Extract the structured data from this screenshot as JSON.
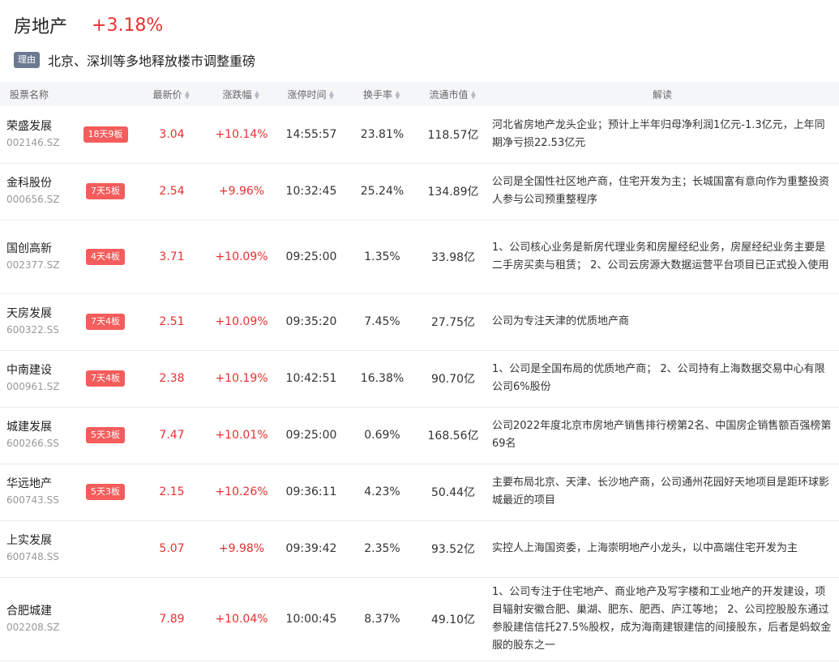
{
  "header": {
    "sector": "房地产",
    "change": "+3.18%"
  },
  "reason": {
    "tag": "理由",
    "text": "北京、深圳等多地释放楼市调整重磅"
  },
  "columns": {
    "name": "股票名称",
    "price": "最新价",
    "change": "涨跌幅",
    "limit_time": "涨停时间",
    "turnover": "换手率",
    "cap": "流通市值",
    "desc": "解读"
  },
  "colors": {
    "up": "#e93030",
    "badge": "#f55c5c",
    "reason_tag": "#6b7a90"
  },
  "rows": [
    {
      "name": "荣盛发展",
      "code": "002146.SZ",
      "badge": "18天9板",
      "price": "3.04",
      "change": "+10.14%",
      "time": "14:55:57",
      "turnover": "23.81%",
      "cap": "118.57亿",
      "desc": "河北省房地产龙头企业；预计上半年归母净利润1亿元-1.3亿元，上年同期净亏损22.53亿元"
    },
    {
      "name": "金科股份",
      "code": "000656.SZ",
      "badge": "7天5板",
      "price": "2.54",
      "change": "+9.96%",
      "time": "10:32:45",
      "turnover": "25.24%",
      "cap": "134.89亿",
      "desc": "公司是全国性社区地产商，住宅开发为主；长城国富有意向作为重整投资人参与公司预重整程序"
    },
    {
      "name": "国创高新",
      "code": "002377.SZ",
      "badge": "4天4板",
      "price": "3.71",
      "change": "+10.09%",
      "time": "09:25:00",
      "turnover": "1.35%",
      "cap": "33.98亿",
      "desc": "1、公司核心业务是新房代理业务和房屋经纪业务，房屋经纪业务主要是二手房买卖与租赁； 2、公司云房源大数据运营平台项目已正式投入使用"
    },
    {
      "name": "天房发展",
      "code": "600322.SS",
      "badge": "7天4板",
      "price": "2.51",
      "change": "+10.09%",
      "time": "09:35:20",
      "turnover": "7.45%",
      "cap": "27.75亿",
      "desc": "公司为专注天津的优质地产商"
    },
    {
      "name": "中南建设",
      "code": "000961.SZ",
      "badge": "7天4板",
      "price": "2.38",
      "change": "+10.19%",
      "time": "10:42:51",
      "turnover": "16.38%",
      "cap": "90.70亿",
      "desc": "1、公司是全国布局的优质地产商； 2、公司持有上海数据交易中心有限公司6%股份"
    },
    {
      "name": "城建发展",
      "code": "600266.SS",
      "badge": "5天3板",
      "price": "7.47",
      "change": "+10.01%",
      "time": "09:25:00",
      "turnover": "0.69%",
      "cap": "168.56亿",
      "desc": "公司2022年度北京市房地产销售排行榜第2名、中国房企销售额百强榜第69名"
    },
    {
      "name": "华远地产",
      "code": "600743.SS",
      "badge": "5天3板",
      "price": "2.15",
      "change": "+10.26%",
      "time": "09:36:11",
      "turnover": "4.23%",
      "cap": "50.44亿",
      "desc": "主要布局北京、天津、长沙地产商，公司通州花园好天地项目是距环球影城最近的项目"
    },
    {
      "name": "上实发展",
      "code": "600748.SS",
      "badge": "",
      "price": "5.07",
      "change": "+9.98%",
      "time": "09:39:42",
      "turnover": "2.35%",
      "cap": "93.52亿",
      "desc": "实控人上海国资委，上海崇明地产小龙头，以中高端住宅开发为主"
    },
    {
      "name": "合肥城建",
      "code": "002208.SZ",
      "badge": "",
      "price": "7.89",
      "change": "+10.04%",
      "time": "10:00:45",
      "turnover": "8.37%",
      "cap": "49.10亿",
      "desc": "1、公司专注于住宅地产、商业地产及写字楼和工业地产的开发建设，项目辐射安徽合肥、巢湖、肥东、肥西、庐江等地； 2、公司控股股东通过参股建信信托27.5%股权，成为海南建银建信的间接股东，后者是蚂蚁金服的股东之一"
    }
  ]
}
